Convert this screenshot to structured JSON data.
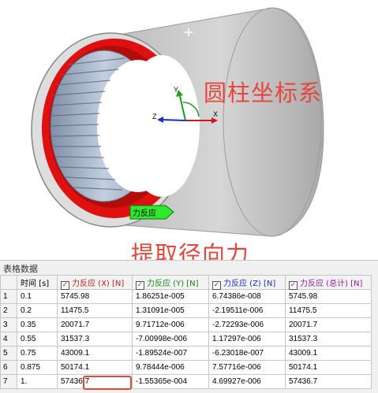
{
  "annotations": {
    "cylindrical_cs": "圆柱坐标系",
    "extract_radial": "提取径向力"
  },
  "viewport": {
    "label_tag": "力反应",
    "axes": {
      "x": "X",
      "y": "Y",
      "z": "Z"
    }
  },
  "table": {
    "title": "表格数据",
    "headers": [
      "时间 [s]",
      "力反应 (X) [N]",
      "力反应 (Y) [N]",
      "力反应 (Z) [N]",
      "力反应 (总计) [N]"
    ],
    "rows": [
      [
        "1",
        "0.1",
        "5745.98",
        "1.86251e-005",
        "6.74386e-008",
        "5745.98"
      ],
      [
        "2",
        "0.2",
        "11475.5",
        "1.31091e-005",
        "-2.19511e-006",
        "11475.5"
      ],
      [
        "3",
        "0.35",
        "20071.7",
        "9.71712e-006",
        "-2.72293e-006",
        "20071.7"
      ],
      [
        "4",
        "0.55",
        "31537.3",
        "-7.00998e-006",
        "1.17297e-006",
        "31537.3"
      ],
      [
        "5",
        "0.75",
        "43009.1",
        "-1.89524e-007",
        "-6.23018e-007",
        "43009.1"
      ],
      [
        "6",
        "0.875",
        "50174.1",
        "9.78444e-006",
        "7.57716e-006",
        "50174.1"
      ],
      [
        "7",
        "1.",
        "57436.7",
        "-1.55365e-004",
        "4.69927e-006",
        "57436.7"
      ]
    ]
  },
  "colors": {
    "annotation": "#e8463c",
    "cylinder_outer": "#c9c9c9",
    "cylinder_inner_red": "#e01010",
    "tag_green": "#2ee82e"
  }
}
